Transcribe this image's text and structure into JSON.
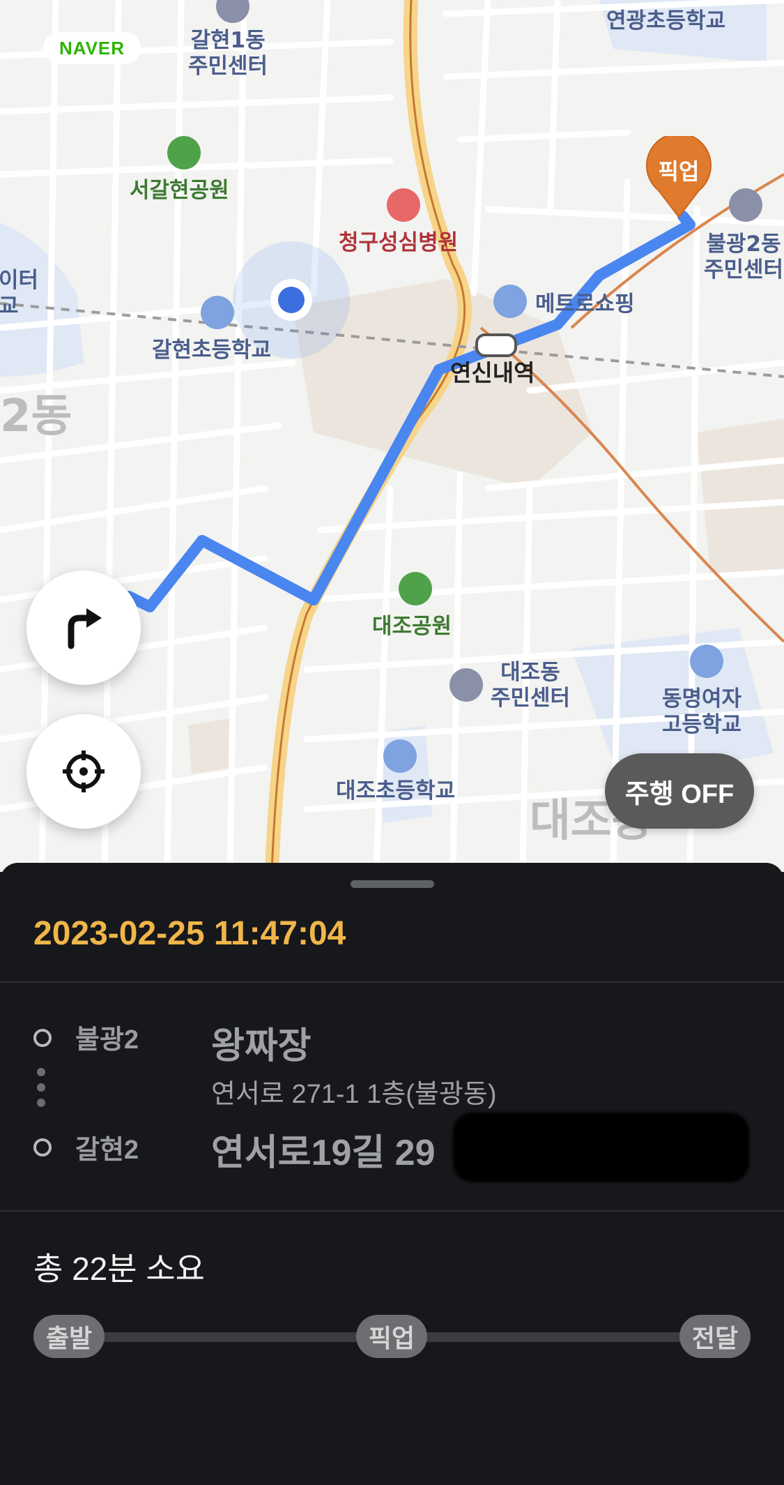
{
  "map": {
    "brand": "NAVER",
    "labels": {
      "galhyeon1_center_l1": "갈현1동",
      "galhyeon1_center_l2": "주민센터",
      "yeongwang_school": "연광초등학교",
      "seogalhyeon_park": "서갈현공원",
      "cheonggu_hospital": "청구성심병원",
      "bulgwang2_center_l1": "불광2동",
      "bulgwang2_center_l2": "주민센터",
      "left_edge_l1": "이터",
      "left_edge_l2": "교",
      "metro_shopping": "메트로쇼핑",
      "galhyeon_school": "갈현초등학교",
      "yeonsinnae_station": "연신내역",
      "district_2dong": "2동",
      "daejo_park": "대조공원",
      "daejo_center_l1": "대조동",
      "daejo_center_l2": "주민센터",
      "dongmyeong_school_l1": "동명여자",
      "dongmyeong_school_l2": "고등학교",
      "daejo_school": "대조초등학교",
      "district_daejo": "대조동"
    },
    "pickup_marker": "픽업",
    "turn_button_icon": "turn-right-icon",
    "locate_button_icon": "crosshair-icon",
    "drive_toggle": "주행 OFF"
  },
  "sheet": {
    "datetime": "2023-02-25 11:47:04",
    "origin_area": "불광2",
    "destination_area": "갈현2",
    "shop_name": "왕짜장",
    "shop_address": "연서로 271-1 1층(불광동)",
    "destination_address": "연서로19길 29",
    "total_time": "총 22분 소요",
    "steps": [
      "출발",
      "픽업",
      "전달"
    ]
  },
  "colors": {
    "route": "#4a86f0",
    "pickup_marker": "#e07a2c",
    "datetime": "#f0b64a",
    "sheet_bg": "#17181b"
  }
}
